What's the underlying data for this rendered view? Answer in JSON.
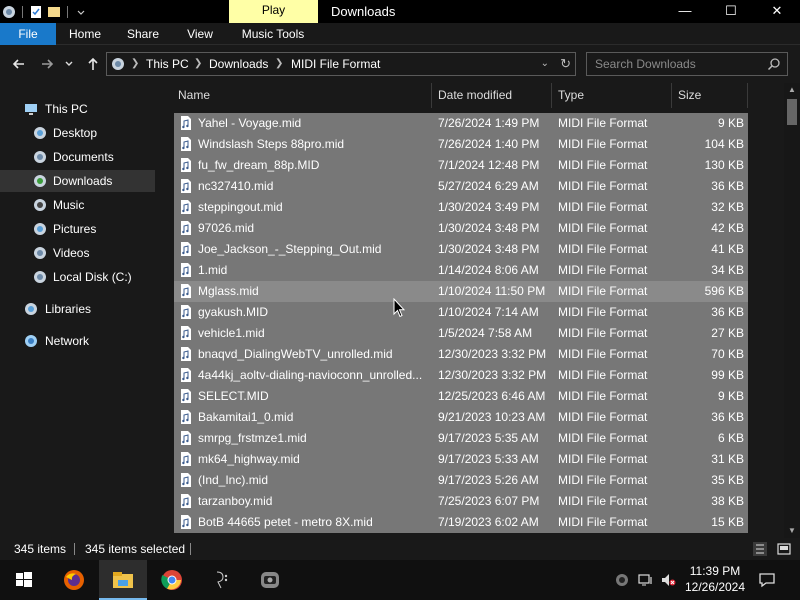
{
  "window": {
    "title": "Downloads",
    "context_tab": "Play",
    "controls": {
      "minimize": "—",
      "maximize": "☐",
      "close": "✕"
    }
  },
  "ribbon": {
    "tabs": [
      "File",
      "Home",
      "Share",
      "View",
      "Music Tools"
    ],
    "file_color": "#1979ca"
  },
  "address": {
    "crumbs": [
      "This PC",
      "Downloads",
      "MIDI File Format"
    ],
    "search_placeholder": "Search Downloads"
  },
  "nav": {
    "items": [
      {
        "label": "This PC",
        "icon": "pc-icon"
      },
      {
        "label": "Desktop",
        "icon": "desktop-icon"
      },
      {
        "label": "Documents",
        "icon": "documents-icon"
      },
      {
        "label": "Downloads",
        "icon": "downloads-icon",
        "selected": true
      },
      {
        "label": "Music",
        "icon": "music-icon"
      },
      {
        "label": "Pictures",
        "icon": "pictures-icon"
      },
      {
        "label": "Videos",
        "icon": "videos-icon"
      },
      {
        "label": "Local Disk (C:)",
        "icon": "disk-icon"
      },
      {
        "label": "Libraries",
        "icon": "libraries-icon"
      },
      {
        "label": "Network",
        "icon": "network-icon"
      }
    ]
  },
  "columns": {
    "name": "Name",
    "date": "Date modified",
    "type": "Type",
    "size": "Size"
  },
  "files": [
    {
      "name": "Yahel - Voyage.mid",
      "date": "7/26/2024 1:49 PM",
      "type": "MIDI File Format",
      "size": "9 KB"
    },
    {
      "name": "Windslash Steps 88pro.mid",
      "date": "7/26/2024 1:40 PM",
      "type": "MIDI File Format",
      "size": "104 KB"
    },
    {
      "name": "fu_fw_dream_88p.MID",
      "date": "7/1/2024 12:48 PM",
      "type": "MIDI File Format",
      "size": "130 KB"
    },
    {
      "name": "nc327410.mid",
      "date": "5/27/2024 6:29 AM",
      "type": "MIDI File Format",
      "size": "36 KB"
    },
    {
      "name": "steppingout.mid",
      "date": "1/30/2024 3:49 PM",
      "type": "MIDI File Format",
      "size": "32 KB"
    },
    {
      "name": "97026.mid",
      "date": "1/30/2024 3:48 PM",
      "type": "MIDI File Format",
      "size": "42 KB"
    },
    {
      "name": "Joe_Jackson_-_Stepping_Out.mid",
      "date": "1/30/2024 3:48 PM",
      "type": "MIDI File Format",
      "size": "41 KB"
    },
    {
      "name": "1.mid",
      "date": "1/14/2024 8:06 AM",
      "type": "MIDI File Format",
      "size": "34 KB"
    },
    {
      "name": "Mglass.mid",
      "date": "1/10/2024 11:50 PM",
      "type": "MIDI File Format",
      "size": "596 KB",
      "hover": true
    },
    {
      "name": "gyakush.MID",
      "date": "1/10/2024 7:14 AM",
      "type": "MIDI File Format",
      "size": "36 KB"
    },
    {
      "name": "vehicle1.mid",
      "date": "1/5/2024 7:58 AM",
      "type": "MIDI File Format",
      "size": "27 KB"
    },
    {
      "name": "bnaqvd_DialingWebTV_unrolled.mid",
      "date": "12/30/2023 3:32 PM",
      "type": "MIDI File Format",
      "size": "70 KB"
    },
    {
      "name": "4a44kj_aoltv-dialing-navioconn_unrolled...",
      "date": "12/30/2023 3:32 PM",
      "type": "MIDI File Format",
      "size": "99 KB"
    },
    {
      "name": "SELECT.MID",
      "date": "12/25/2023 6:46 AM",
      "type": "MIDI File Format",
      "size": "9 KB"
    },
    {
      "name": "Bakamitai1_0.mid",
      "date": "9/21/2023 10:23 AM",
      "type": "MIDI File Format",
      "size": "36 KB"
    },
    {
      "name": "smrpg_frstmze1.mid",
      "date": "9/17/2023 5:35 AM",
      "type": "MIDI File Format",
      "size": "6 KB"
    },
    {
      "name": "mk64_highway.mid",
      "date": "9/17/2023 5:33 AM",
      "type": "MIDI File Format",
      "size": "31 KB"
    },
    {
      "name": "(Ind_Inc).mid",
      "date": "9/17/2023 5:26 AM",
      "type": "MIDI File Format",
      "size": "35 KB"
    },
    {
      "name": "tarzanboy.mid",
      "date": "7/25/2023 6:07 PM",
      "type": "MIDI File Format",
      "size": "38 KB"
    },
    {
      "name": "BotB 44665 petet - metro 8X.mid",
      "date": "7/19/2023 6:02 AM",
      "type": "MIDI File Format",
      "size": "15 KB"
    }
  ],
  "status": {
    "items": "345 items",
    "selected": "345 items selected"
  },
  "taskbar": {
    "apps": [
      "start-icon",
      "firefox-icon",
      "file-explorer-icon",
      "chrome-icon",
      "midi-app-icon",
      "media-app-icon"
    ],
    "time": "11:39 PM",
    "date": "12/26/2024"
  },
  "colors": {
    "selection_row": "#777777",
    "hover_row": "#8a8a8a",
    "context_tab": "#ffffa6",
    "accent": "#1979ca"
  }
}
